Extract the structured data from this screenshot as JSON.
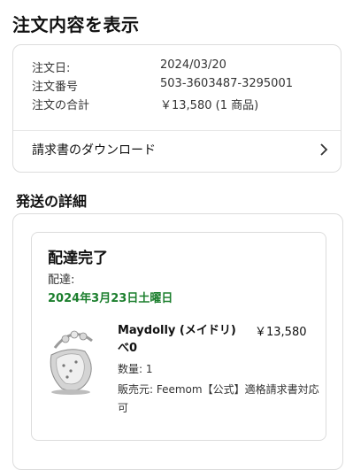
{
  "page_title": "注文内容を表示",
  "summary": {
    "rows": [
      {
        "key": "注文日:",
        "value": "2024/03/20"
      },
      {
        "key": "注文番号",
        "value": "503-3603487-3295001"
      },
      {
        "key": "注文の合計",
        "value": "￥13,580 (1 商品)"
      }
    ],
    "download_label": "請求書のダウンロード",
    "chevron_icon": "chevron-right-icon"
  },
  "shipping": {
    "section_title": "発送の詳細",
    "status": "配達完了",
    "delivery_label": "配達:",
    "delivery_date": "2024年3月23日土曜日",
    "delivery_date_color": "#1c7f2e",
    "product": {
      "name": "Maydolly (メイドリ) べ0",
      "price": "￥13,580",
      "quantity": "数量: 1",
      "seller": "販売元: Feemom【公式】適格請求書対応可",
      "image_icon": "baby-bouncer-product-image"
    }
  }
}
